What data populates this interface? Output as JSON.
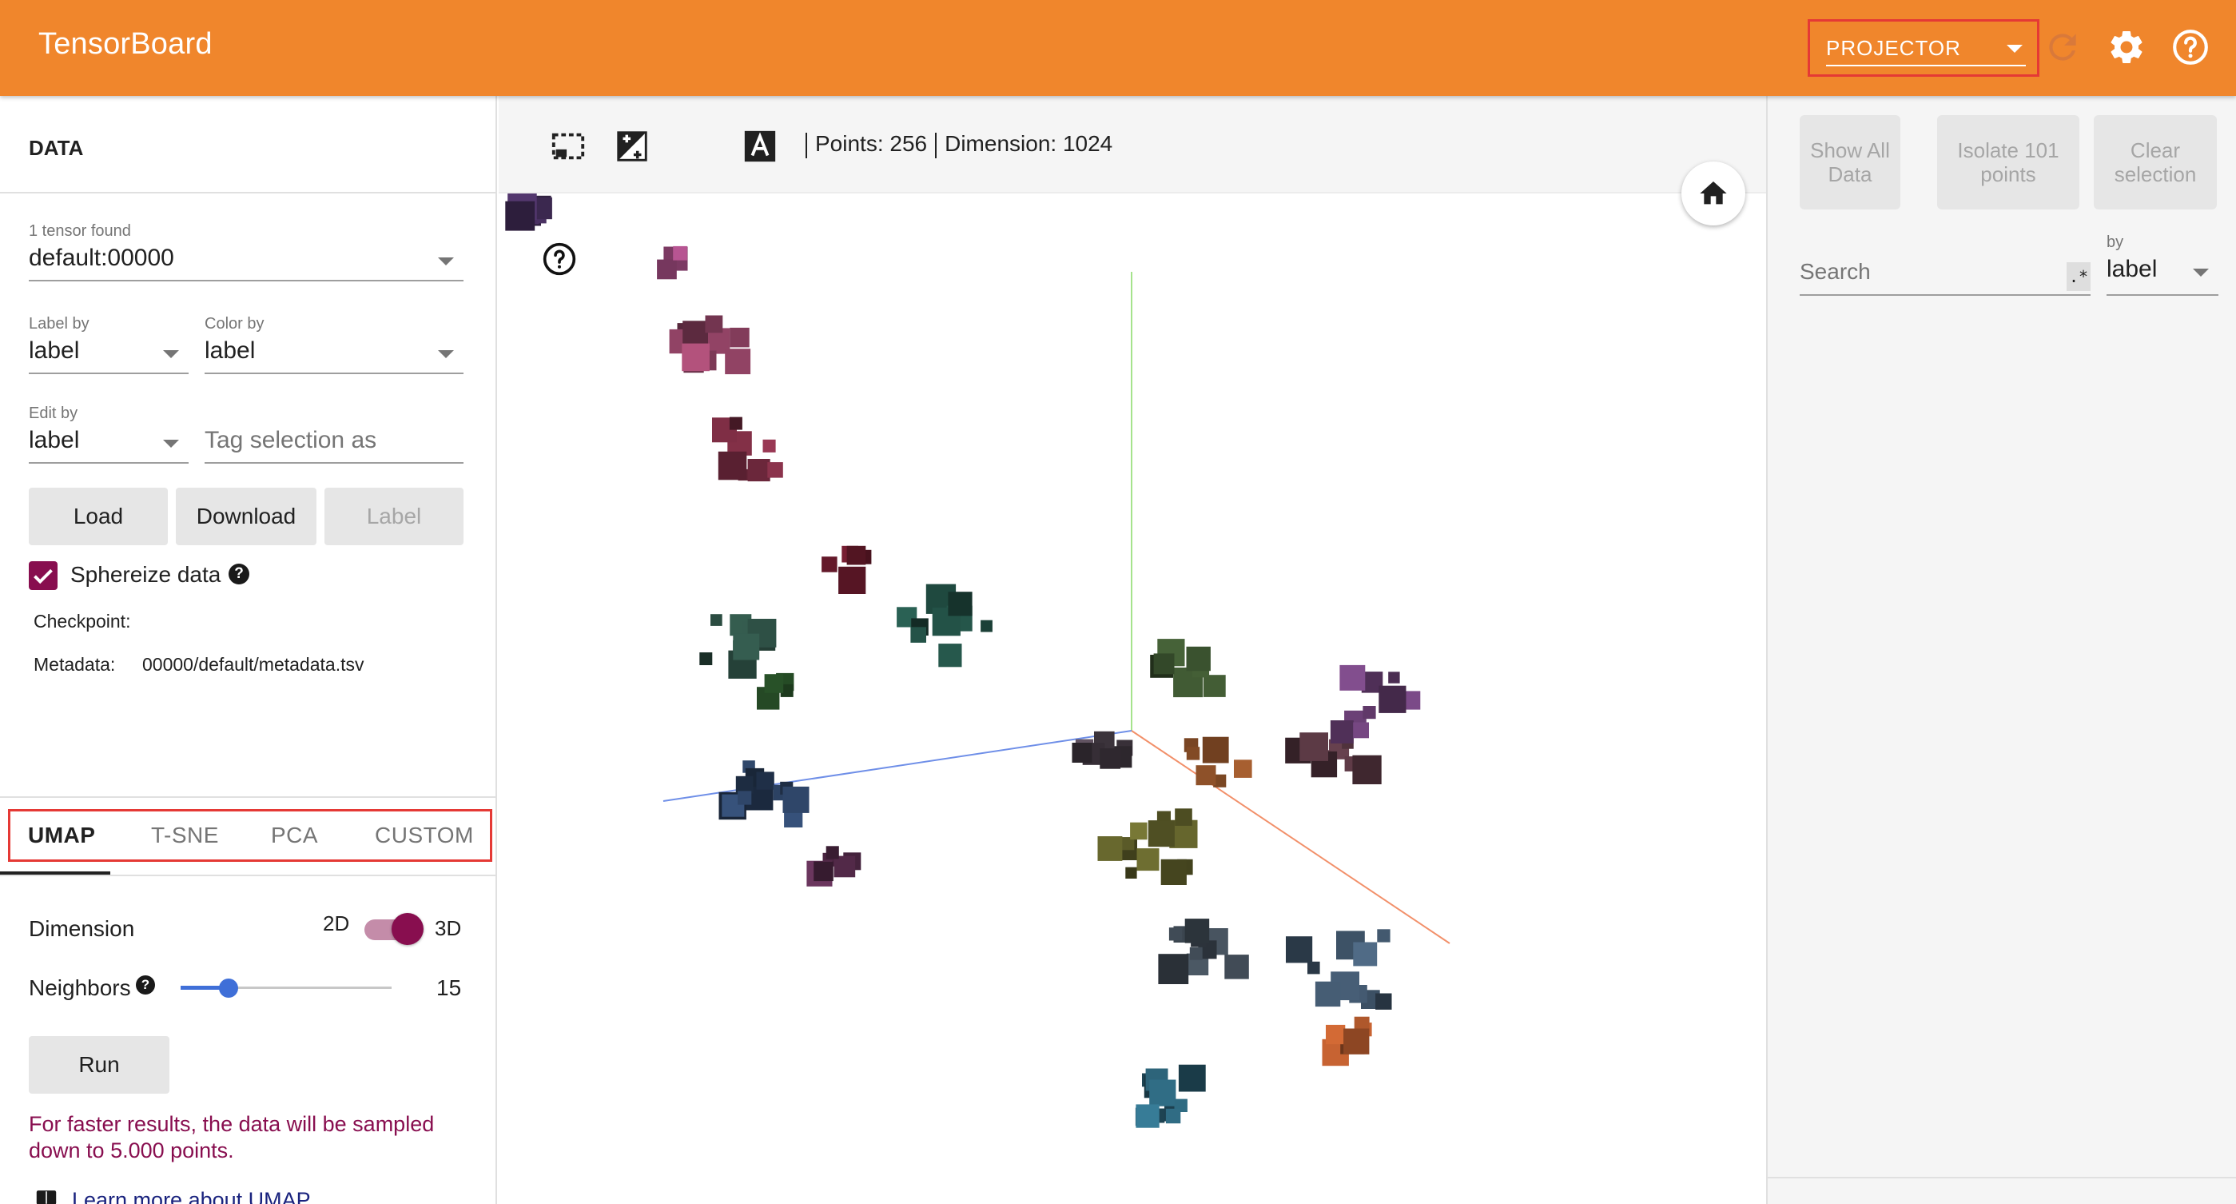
{
  "header": {
    "brand": "TensorBoard",
    "plugin_select": "PROJECTOR",
    "icons": [
      "refresh-icon",
      "settings-gear-icon",
      "help-icon"
    ]
  },
  "data_panel": {
    "title": "DATA",
    "tensor": {
      "label": "1 tensor found",
      "value": "default:00000"
    },
    "label_by": {
      "label": "Label by",
      "value": "label"
    },
    "color_by": {
      "label": "Color by",
      "value": "label"
    },
    "edit_by": {
      "label": "Edit by",
      "value": "label"
    },
    "tag_selection_placeholder": "Tag selection as",
    "buttons": {
      "load": "Load",
      "download": "Download",
      "label": "Label"
    },
    "sphereize": {
      "label": "Sphereize data",
      "checked": true
    },
    "checkpoint": {
      "key": "Checkpoint:",
      "value": ""
    },
    "metadata": {
      "key": "Metadata:",
      "value": "00000/default/metadata.tsv"
    }
  },
  "projection": {
    "tabs": [
      {
        "label": "UMAP",
        "active": true
      },
      {
        "label": "T-SNE",
        "active": false
      },
      {
        "label": "PCA",
        "active": false
      },
      {
        "label": "CUSTOM",
        "active": false
      }
    ],
    "dimension": {
      "label": "Dimension",
      "left": "2D",
      "right": "3D",
      "selected": "3D"
    },
    "neighbors": {
      "label": "Neighbors",
      "value": "15",
      "min": 5,
      "max": 50
    },
    "run_label": "Run",
    "note": "For faster results, the data will be sampled down to 5.000 points.",
    "learn_more": "Learn more about UMAP"
  },
  "toolbar": {
    "points_label": "Points: 256",
    "dimension_label": "Dimension: 1024",
    "icons": [
      "select-rectangle-icon",
      "night-mode-icon",
      "contrast-icon",
      "label-toggle-icon"
    ]
  },
  "inspector": {
    "show_all": "Show All Data",
    "isolate": "Isolate 101 points",
    "clear": "Clear selection",
    "search_placeholder": "Search",
    "regex_badge": ".*",
    "by_label": "by",
    "by_value": "label"
  },
  "colors": {
    "header": "#f0862c",
    "accent": "#880e4f",
    "highlight_box": "#e53935",
    "slider": "#3f6fd8",
    "axis_y": "#a5e38c",
    "axis_x": "#f2906a",
    "axis_z": "#6f8fe8"
  }
}
